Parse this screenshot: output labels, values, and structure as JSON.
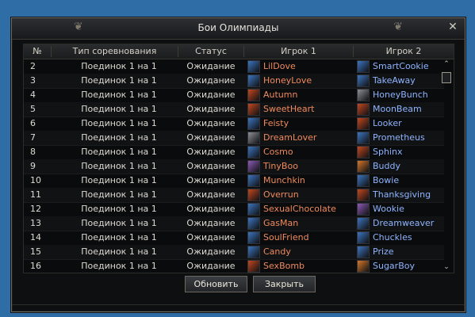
{
  "window": {
    "title": "Бои Олимпиады",
    "close_glyph": "✕"
  },
  "table": {
    "columns": [
      "№",
      "Тип соревнования",
      "Статус",
      "Игрок 1",
      "Игрок 2"
    ],
    "rows": [
      {
        "no": "2",
        "type": "Поединок 1 на 1",
        "status": "Ожидание",
        "p1": "LilDove",
        "p1_avatar": "blue",
        "p2": "SmartCookie",
        "p2_avatar": "blue"
      },
      {
        "no": "3",
        "type": "Поединок 1 на 1",
        "status": "Ожидание",
        "p1": "HoneyLove",
        "p1_avatar": "blue",
        "p2": "TakeAway",
        "p2_avatar": "blue"
      },
      {
        "no": "4",
        "type": "Поединок 1 на 1",
        "status": "Ожидание",
        "p1": "Autumn",
        "p1_avatar": "red",
        "p2": "HoneyBunch",
        "p2_avatar": "gray"
      },
      {
        "no": "5",
        "type": "Поединок 1 на 1",
        "status": "Ожидание",
        "p1": "SweetHeart",
        "p1_avatar": "red",
        "p2": "MoonBeam",
        "p2_avatar": "red"
      },
      {
        "no": "6",
        "type": "Поединок 1 на 1",
        "status": "Ожидание",
        "p1": "Feisty",
        "p1_avatar": "blue",
        "p2": "Looker",
        "p2_avatar": "red"
      },
      {
        "no": "7",
        "type": "Поединок 1 на 1",
        "status": "Ожидание",
        "p1": "DreamLover",
        "p1_avatar": "gray",
        "p2": "Prometheus",
        "p2_avatar": "blue"
      },
      {
        "no": "8",
        "type": "Поединок 1 на 1",
        "status": "Ожидание",
        "p1": "Cosmo",
        "p1_avatar": "blue",
        "p2": "Sphinx",
        "p2_avatar": "red"
      },
      {
        "no": "9",
        "type": "Поединок 1 на 1",
        "status": "Ожидание",
        "p1": "TinyBoo",
        "p1_avatar": "purple",
        "p2": "Buddy",
        "p2_avatar": "orange"
      },
      {
        "no": "10",
        "type": "Поединок 1 на 1",
        "status": "Ожидание",
        "p1": "Munchkin",
        "p1_avatar": "blue",
        "p2": "Bowie",
        "p2_avatar": "blue"
      },
      {
        "no": "11",
        "type": "Поединок 1 на 1",
        "status": "Ожидание",
        "p1": "Overrun",
        "p1_avatar": "red",
        "p2": "Thanksgiving",
        "p2_avatar": "red"
      },
      {
        "no": "12",
        "type": "Поединок 1 на 1",
        "status": "Ожидание",
        "p1": "SexualChocolate",
        "p1_avatar": "blue",
        "p2": "Wookie",
        "p2_avatar": "purple"
      },
      {
        "no": "13",
        "type": "Поединок 1 на 1",
        "status": "Ожидание",
        "p1": "GasMan",
        "p1_avatar": "blue",
        "p2": "Dreamweaver",
        "p2_avatar": "blue"
      },
      {
        "no": "14",
        "type": "Поединок 1 на 1",
        "status": "Ожидание",
        "p1": "SoulFriend",
        "p1_avatar": "blue",
        "p2": "Chuckles",
        "p2_avatar": "blue"
      },
      {
        "no": "15",
        "type": "Поединок 1 на 1",
        "status": "Ожидание",
        "p1": "Candy",
        "p1_avatar": "blue",
        "p2": "Prize",
        "p2_avatar": "blue"
      },
      {
        "no": "16",
        "type": "Поединок 1 на 1",
        "status": "Ожидание",
        "p1": "SexBomb",
        "p1_avatar": "red",
        "p2": "SugarBoy",
        "p2_avatar": "orange"
      }
    ]
  },
  "scrollbar": {
    "up_glyph": "⌃",
    "down_glyph": "⌄",
    "position_fraction": 0.0
  },
  "buttons": {
    "refresh_label": "Обновить",
    "close_label": "Закрыть"
  },
  "colors": {
    "player1_name": "#f08a5d",
    "player2_name": "#8fb4ff",
    "avatar_blue": "#3c75bf",
    "avatar_red": "#c3481f",
    "avatar_gray": "#8c8f95",
    "avatar_purple": "#8d5bb5",
    "avatar_orange": "#d5782a"
  }
}
